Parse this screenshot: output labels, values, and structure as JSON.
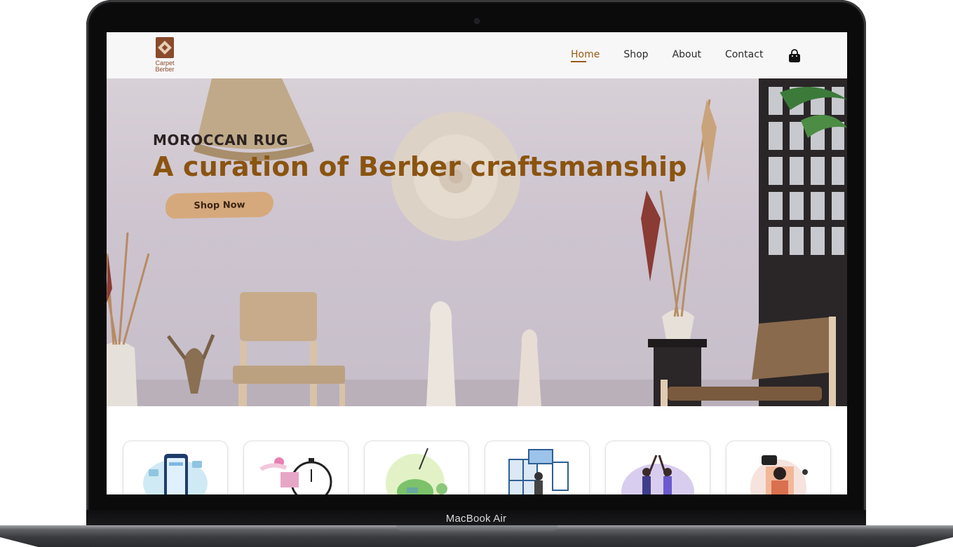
{
  "device": {
    "label": "MacBook Air"
  },
  "brand": {
    "name_line1": "Carpet",
    "name_line2": "Berber"
  },
  "nav": {
    "items": [
      {
        "label": "Home",
        "active": true
      },
      {
        "label": "Shop",
        "active": false
      },
      {
        "label": "About",
        "active": false
      },
      {
        "label": "Contact",
        "active": false
      }
    ],
    "cart_icon": "shopping-bag-icon"
  },
  "hero": {
    "eyebrow": "MOROCCAN RUG",
    "title": "A curation of Berber craftsmanship",
    "cta_label": "Shop Now"
  },
  "features": [
    {
      "illustration": "mobile-payment-illustration"
    },
    {
      "illustration": "fast-delivery-illustration"
    },
    {
      "illustration": "savings-illustration"
    },
    {
      "illustration": "gift-delivery-illustration"
    },
    {
      "illustration": "teamwork-illustration"
    },
    {
      "illustration": "customer-support-illustration"
    }
  ],
  "colors": {
    "accent": "#9a5a12",
    "cta_background": "#d6a97c",
    "header_background": "#f7f7f7",
    "brand": "#8a4a2c"
  }
}
